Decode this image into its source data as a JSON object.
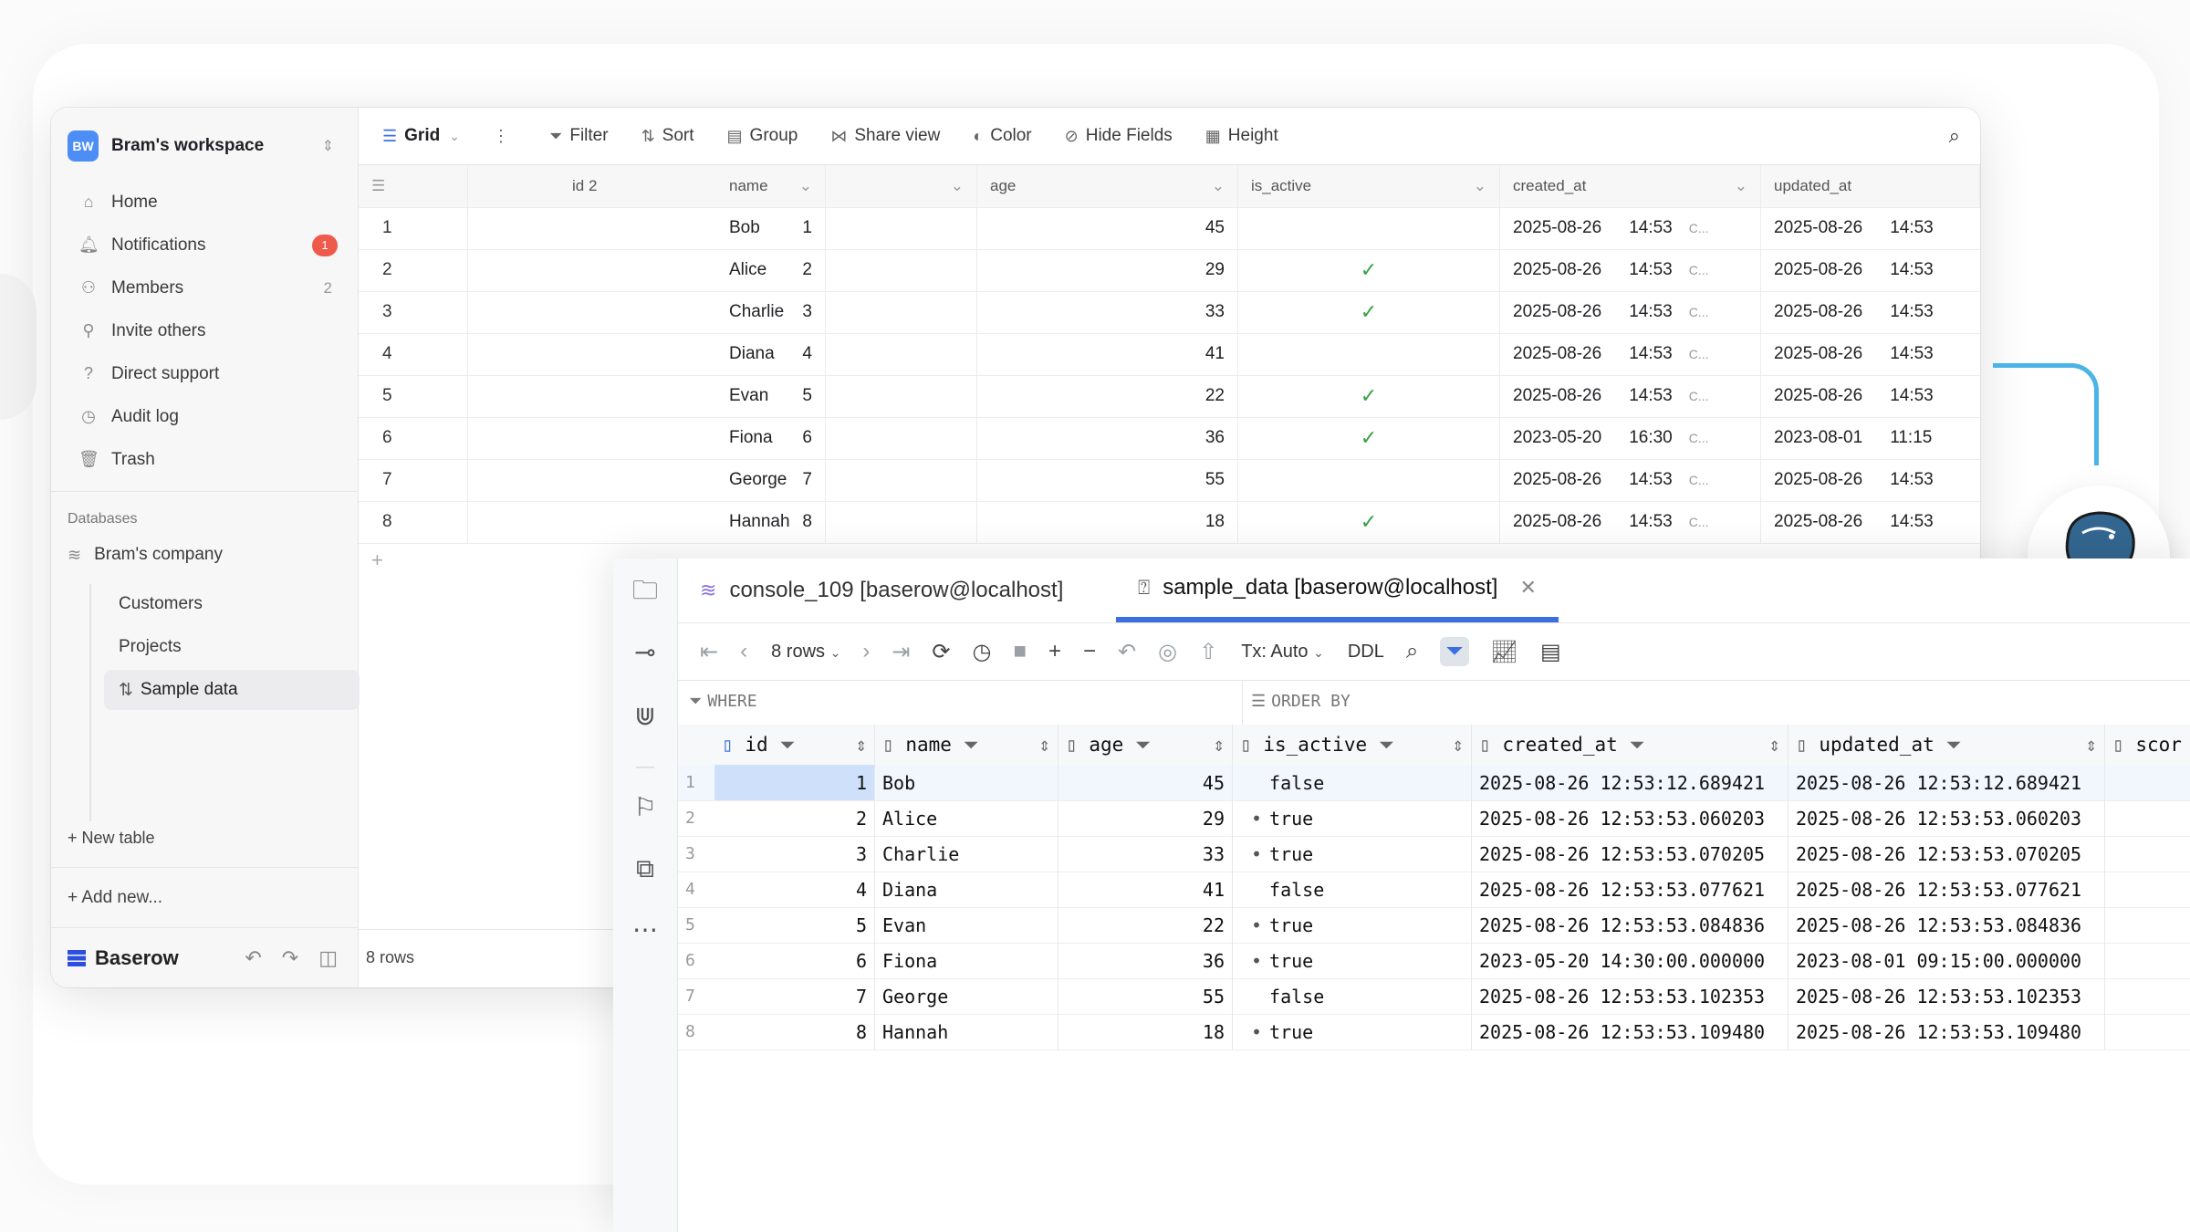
{
  "baserow": {
    "workspace": {
      "initials": "BW",
      "name": "Bram's workspace"
    },
    "nav": [
      {
        "icon": "home-icon",
        "label": "Home"
      },
      {
        "icon": "bell-icon",
        "label": "Notifications",
        "badge": "1"
      },
      {
        "icon": "members-icon",
        "label": "Members",
        "count": "2"
      },
      {
        "icon": "invite-icon",
        "label": "Invite others"
      },
      {
        "icon": "help-icon",
        "label": "Direct support"
      },
      {
        "icon": "audit-icon",
        "label": "Audit log"
      },
      {
        "icon": "trash-icon",
        "label": "Trash"
      }
    ],
    "databases_heading": "Databases",
    "database": "Bram's company",
    "tables": [
      "Customers",
      "Projects",
      "Sample data"
    ],
    "new_table": "+ New table",
    "add_new": "+ Add new...",
    "logo": "Baserow",
    "toolbar": {
      "view": "Grid",
      "filter": "Filter",
      "sort": "Sort",
      "group": "Group",
      "share": "Share view",
      "color": "Color",
      "hide": "Hide Fields",
      "height": "Height"
    },
    "columns": [
      "id 2",
      "name",
      "age",
      "is_active",
      "created_at",
      "updated_at"
    ],
    "rows": [
      {
        "n": "1",
        "id": "1",
        "name": "Bob",
        "age": "45",
        "active": "",
        "cd": "2025-08-26",
        "ct": "14:53",
        "ud": "2025-08-26",
        "ut": "14:53"
      },
      {
        "n": "2",
        "id": "2",
        "name": "Alice",
        "age": "29",
        "active": "✓",
        "cd": "2025-08-26",
        "ct": "14:53",
        "ud": "2025-08-26",
        "ut": "14:53"
      },
      {
        "n": "3",
        "id": "3",
        "name": "Charlie",
        "age": "33",
        "active": "✓",
        "cd": "2025-08-26",
        "ct": "14:53",
        "ud": "2025-08-26",
        "ut": "14:53"
      },
      {
        "n": "4",
        "id": "4",
        "name": "Diana",
        "age": "41",
        "active": "",
        "cd": "2025-08-26",
        "ct": "14:53",
        "ud": "2025-08-26",
        "ut": "14:53"
      },
      {
        "n": "5",
        "id": "5",
        "name": "Evan",
        "age": "22",
        "active": "✓",
        "cd": "2025-08-26",
        "ct": "14:53",
        "ud": "2025-08-26",
        "ut": "14:53"
      },
      {
        "n": "6",
        "id": "6",
        "name": "Fiona",
        "age": "36",
        "active": "✓",
        "cd": "2023-05-20",
        "ct": "16:30",
        "ud": "2023-08-01",
        "ut": "11:15"
      },
      {
        "n": "7",
        "id": "7",
        "name": "George",
        "age": "55",
        "active": "",
        "cd": "2025-08-26",
        "ct": "14:53",
        "ud": "2025-08-26",
        "ut": "14:53"
      },
      {
        "n": "8",
        "id": "8",
        "name": "Hannah",
        "age": "18",
        "active": "✓",
        "cd": "2025-08-26",
        "ct": "14:53",
        "ud": "2025-08-26",
        "ut": "14:53"
      }
    ],
    "tz_short": "C...",
    "footer_rows": "8 rows"
  },
  "dbtool": {
    "tabs": [
      {
        "label": "console_109 [baserow@localhost]"
      },
      {
        "label": "sample_data [baserow@localhost]"
      }
    ],
    "rows_label": "8 rows",
    "tx": "Tx: Auto",
    "ddl": "DDL",
    "where": "WHERE",
    "order_by": "ORDER BY",
    "columns": [
      "id",
      "name",
      "age",
      "is_active",
      "created_at",
      "updated_at",
      "scor"
    ],
    "rows": [
      {
        "n": "1",
        "id": "1",
        "name": "Bob",
        "age": "45",
        "active": "false",
        "created": "2025-08-26 12:53:12.689421",
        "updated": "2025-08-26 12:53:12.689421"
      },
      {
        "n": "2",
        "id": "2",
        "name": "Alice",
        "age": "29",
        "active": "true",
        "created": "2025-08-26 12:53:53.060203",
        "updated": "2025-08-26 12:53:53.060203"
      },
      {
        "n": "3",
        "id": "3",
        "name": "Charlie",
        "age": "33",
        "active": "true",
        "created": "2025-08-26 12:53:53.070205",
        "updated": "2025-08-26 12:53:53.070205"
      },
      {
        "n": "4",
        "id": "4",
        "name": "Diana",
        "age": "41",
        "active": "false",
        "created": "2025-08-26 12:53:53.077621",
        "updated": "2025-08-26 12:53:53.077621"
      },
      {
        "n": "5",
        "id": "5",
        "name": "Evan",
        "age": "22",
        "active": "true",
        "created": "2025-08-26 12:53:53.084836",
        "updated": "2025-08-26 12:53:53.084836"
      },
      {
        "n": "6",
        "id": "6",
        "name": "Fiona",
        "age": "36",
        "active": "true",
        "created": "2023-05-20 14:30:00.000000",
        "updated": "2023-08-01 09:15:00.000000"
      },
      {
        "n": "7",
        "id": "7",
        "name": "George",
        "age": "55",
        "active": "false",
        "created": "2025-08-26 12:53:53.102353",
        "updated": "2025-08-26 12:53:53.102353"
      },
      {
        "n": "8",
        "id": "8",
        "name": "Hannah",
        "age": "18",
        "active": "true",
        "created": "2025-08-26 12:53:53.109480",
        "updated": "2025-08-26 12:53:53.109480"
      }
    ]
  },
  "colors": {
    "accent": "#3b6fe0",
    "badge": "#ef5b4b",
    "check": "#35a045",
    "connector": "#4bb4e6",
    "postgres": "#336791"
  }
}
